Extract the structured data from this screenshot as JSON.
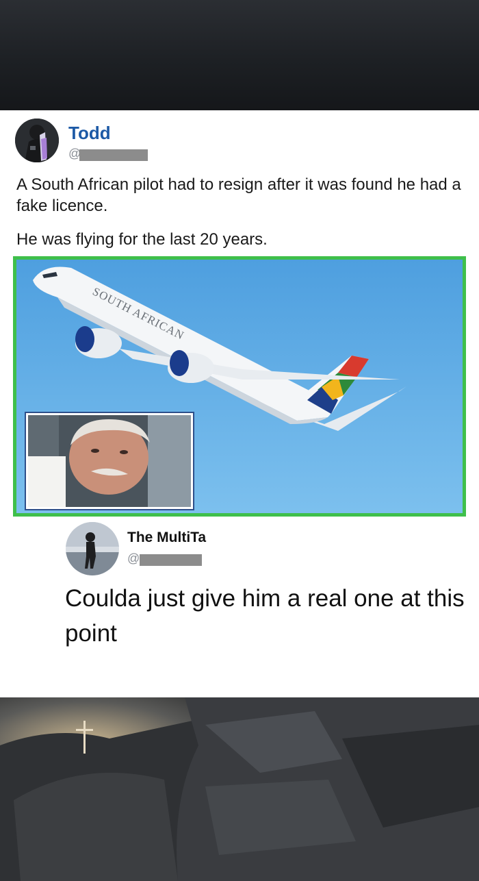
{
  "post": {
    "author_name": "Todd",
    "handle_prefix": "@",
    "text_line1": "A South African pilot had to resign after it was found he had a fake licence.",
    "text_line2": "He was flying for the last 20 years.",
    "media": {
      "airline_text": "SOUTH AFRICAN",
      "border_color": "#3fbf4b"
    }
  },
  "reply": {
    "author_name": "The MultiTa",
    "handle_prefix": "@",
    "text": "Coulda just give him a real one at this point"
  },
  "colors": {
    "author_name": "#1d5aa6",
    "handle": "#8a8f96"
  }
}
